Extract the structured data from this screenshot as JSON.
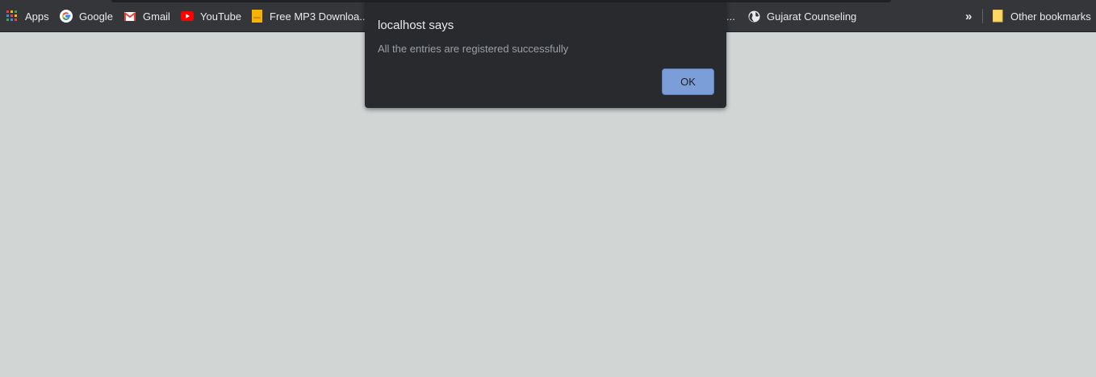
{
  "bookmarks": {
    "apps": "Apps",
    "google": "Google",
    "gmail": "Gmail",
    "youtube": "YouTube",
    "mp3": "Free MP3 Downloa...",
    "truncated": "...",
    "gujarat": "Gujarat Counseling",
    "overflow": "»",
    "other": "Other bookmarks"
  },
  "icons": {
    "apps": "apps-grid-icon",
    "google": "google-icon",
    "gmail": "gmail-icon",
    "youtube": "youtube-icon",
    "mp3": "bookmark-page-icon",
    "gujarat": "globe-icon",
    "other": "folder-icon"
  },
  "dialog": {
    "title": "localhost says",
    "message": "All the entries are registered successfully",
    "ok_label": "OK"
  },
  "colors": {
    "page_background": "#d1d5d4",
    "toolbar": "#35363a",
    "dialog_background": "#292a2d",
    "ok_button": "#7b9ed8"
  }
}
